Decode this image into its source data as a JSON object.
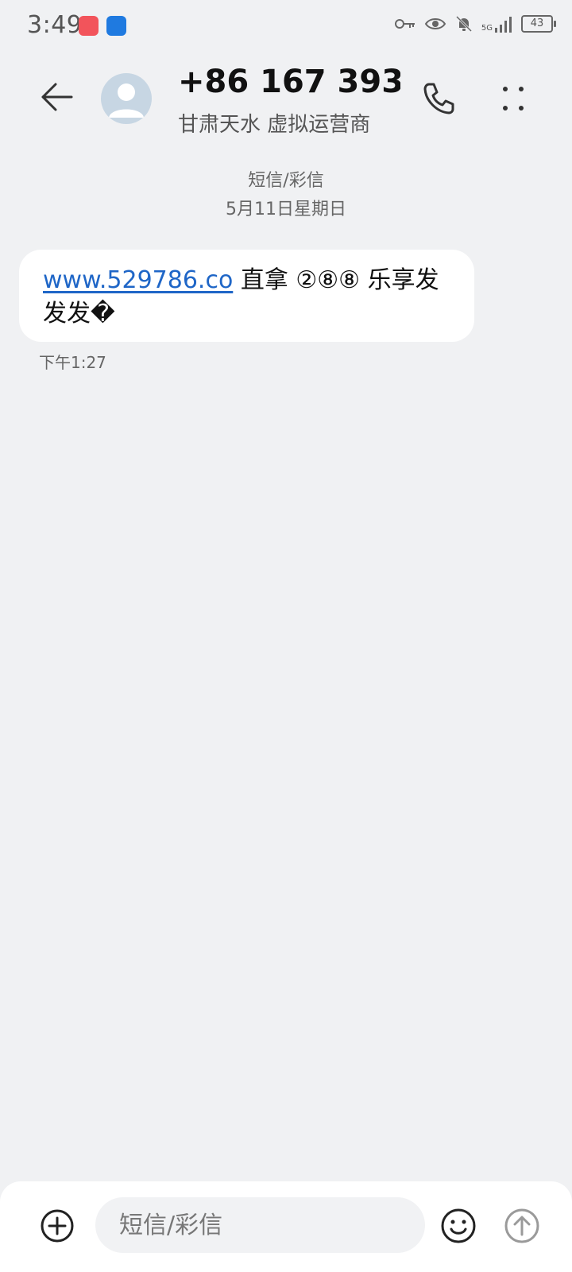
{
  "status_bar": {
    "time": "3:49",
    "network": "5G",
    "battery": "43"
  },
  "header": {
    "contact_name": "+86 167 393…",
    "contact_subtitle": "甘肃天水 虚拟运营商"
  },
  "date_separator": {
    "type": "短信/彩信",
    "date": "5月11日星期日"
  },
  "message": {
    "link": "www.529786.co",
    "text": " 直拿 ②⑧⑧ 乐享发发发�",
    "time": "下午1:27"
  },
  "compose": {
    "placeholder": "短信/彩信"
  },
  "icons": {
    "back": "arrow-left-icon",
    "call": "phone-icon",
    "more": "more-dots-icon",
    "add": "plus-circle-icon",
    "emoji": "smile-icon",
    "send": "send-up-icon"
  },
  "colors": {
    "background": "#f0f1f3",
    "bubble": "#ffffff",
    "link": "#1f66c7"
  }
}
